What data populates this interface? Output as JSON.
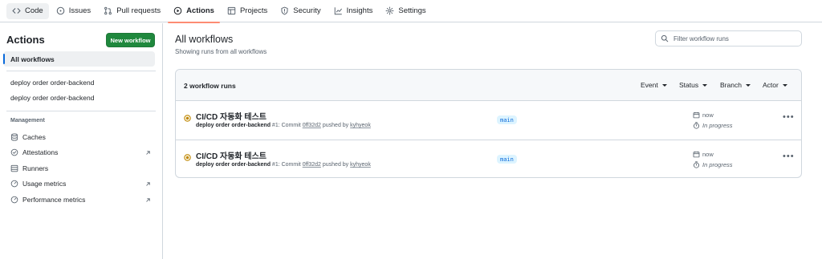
{
  "nav": {
    "items": [
      {
        "label": "Code",
        "icon": "code-icon"
      },
      {
        "label": "Issues",
        "icon": "issue-opened-icon"
      },
      {
        "label": "Pull requests",
        "icon": "git-pull-request-icon"
      },
      {
        "label": "Actions",
        "icon": "play-icon"
      },
      {
        "label": "Projects",
        "icon": "table-icon"
      },
      {
        "label": "Security",
        "icon": "shield-icon"
      },
      {
        "label": "Insights",
        "icon": "graph-icon"
      },
      {
        "label": "Settings",
        "icon": "gear-icon"
      }
    ],
    "selected": "Actions",
    "accent": "#fd8c73"
  },
  "sidebar": {
    "title": "Actions",
    "new_workflow": "New workflow",
    "all_workflows": "All workflows",
    "workflows": [
      "deploy order order-backend",
      "deploy order order-backend"
    ],
    "management_heading": "Management",
    "management": [
      {
        "label": "Caches",
        "icon": "database-icon",
        "external": false
      },
      {
        "label": "Attestations",
        "icon": "verified-icon",
        "external": true
      },
      {
        "label": "Runners",
        "icon": "server-icon",
        "external": false
      },
      {
        "label": "Usage metrics",
        "icon": "meter-icon",
        "external": true
      },
      {
        "label": "Performance metrics",
        "icon": "meter-icon",
        "external": true
      }
    ]
  },
  "main": {
    "title": "All workflows",
    "subtitle": "Showing runs from all workflows",
    "filter_placeholder": "Filter workflow runs",
    "run_count": "2 workflow runs",
    "filters": [
      "Event",
      "Status",
      "Branch",
      "Actor"
    ],
    "runs": [
      {
        "title": "CI/CD 자동화 테스트",
        "workflow": "deploy order order-backend",
        "run_number": "#1",
        "commit_label": "Commit",
        "commit": "0ff32d2",
        "pushed_by": "pushed by",
        "actor": "kyhyeok",
        "branch": "main",
        "when": "now",
        "duration": "In progress",
        "status": "in-progress"
      },
      {
        "title": "CI/CD 자동화 테스트",
        "workflow": "deploy order order-backend",
        "run_number": "#1",
        "commit_label": "Commit",
        "commit": "0ff32d2",
        "pushed_by": "pushed by",
        "actor": "kyhyeok",
        "branch": "main",
        "when": "now",
        "duration": "In progress",
        "status": "in-progress"
      }
    ],
    "status_color": "#bf8700",
    "primary_button_color": "#1f883d"
  }
}
